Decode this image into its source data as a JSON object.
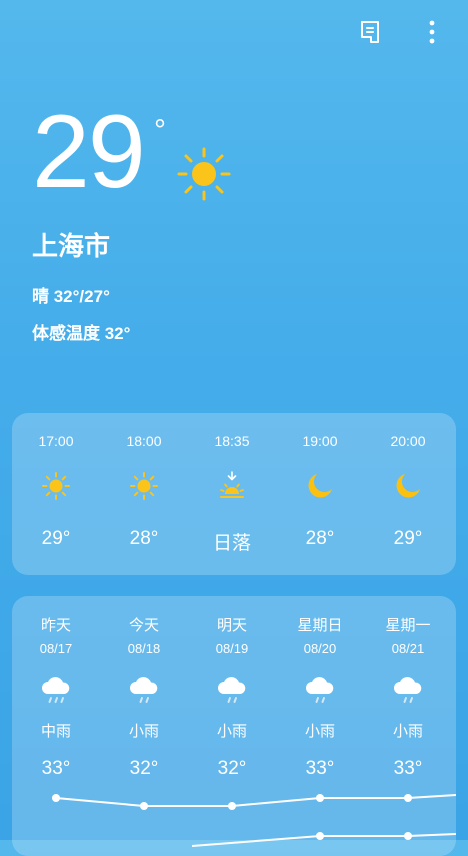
{
  "current": {
    "temperature": "29",
    "degree_symbol": "°",
    "city": "上海市",
    "condition_range": "晴  32°/27°",
    "feels_like": "体感温度 32°"
  },
  "hourly": [
    {
      "time": "17:00",
      "value": "29°",
      "icon": "sun-icon"
    },
    {
      "time": "18:00",
      "value": "28°",
      "icon": "sun-icon"
    },
    {
      "time": "18:35",
      "value": "日落",
      "icon": "sunset-icon"
    },
    {
      "time": "19:00",
      "value": "28°",
      "icon": "moon-icon"
    },
    {
      "time": "20:00",
      "value": "29°",
      "icon": "moon-icon"
    }
  ],
  "daily": [
    {
      "name": "昨天",
      "date": "08/17",
      "desc": "中雨",
      "high": "33°",
      "icon": "rain-cloud-icon"
    },
    {
      "name": "今天",
      "date": "08/18",
      "desc": "小雨",
      "high": "32°",
      "icon": "rain-cloud-icon"
    },
    {
      "name": "明天",
      "date": "08/19",
      "desc": "小雨",
      "high": "32°",
      "icon": "rain-cloud-icon"
    },
    {
      "name": "星期日",
      "date": "08/20",
      "desc": "小雨",
      "high": "33°",
      "icon": "rain-cloud-icon"
    },
    {
      "name": "星期一",
      "date": "08/21",
      "desc": "小雨",
      "high": "33°",
      "icon": "rain-cloud-icon"
    }
  ],
  "colors": {
    "sun": "#fbc41a",
    "moon": "#fcc10e",
    "background_top": "#54b8ec",
    "background_bottom": "#3aa4e6"
  }
}
